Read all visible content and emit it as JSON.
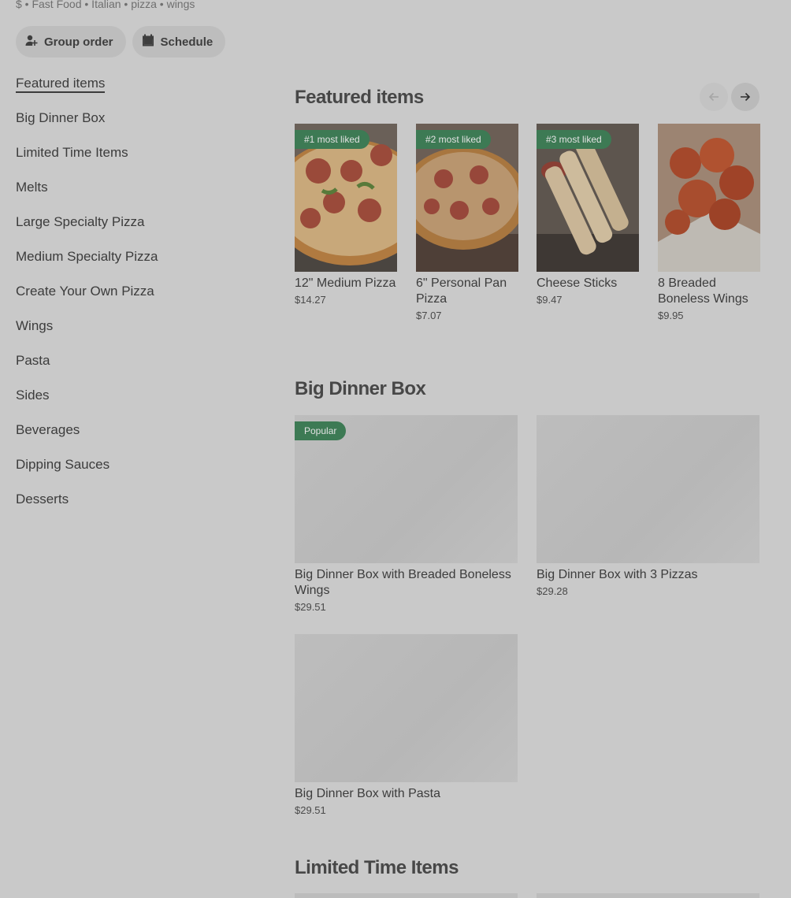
{
  "store": {
    "meta": "$ • Fast Food • Italian • pizza • wings"
  },
  "actions": {
    "group_order": "Group order",
    "schedule": "Schedule"
  },
  "sidebar": {
    "items": [
      {
        "label": "Featured items",
        "active": true
      },
      {
        "label": "Big Dinner Box"
      },
      {
        "label": "Limited Time Items"
      },
      {
        "label": "Melts"
      },
      {
        "label": "Large Specialty Pizza"
      },
      {
        "label": "Medium Specialty Pizza"
      },
      {
        "label": "Create Your Own Pizza"
      },
      {
        "label": "Wings"
      },
      {
        "label": "Pasta"
      },
      {
        "label": "Sides"
      },
      {
        "label": "Beverages"
      },
      {
        "label": "Dipping Sauces"
      },
      {
        "label": "Desserts"
      }
    ]
  },
  "featured": {
    "title": "Featured items",
    "items": [
      {
        "badge": "#1 most liked",
        "name": "12\" Medium Pizza",
        "price": "$14.27"
      },
      {
        "badge": "#2 most liked",
        "name": "6\" Personal Pan Pizza",
        "price": "$7.07"
      },
      {
        "badge": "#3 most liked",
        "name": "Cheese Sticks",
        "price": "$9.47"
      },
      {
        "badge": "",
        "name": "8 Breaded Boneless Wings",
        "price": "$9.95"
      }
    ]
  },
  "big_dinner_box": {
    "title": "Big Dinner Box",
    "items": [
      {
        "badge": "Popular",
        "name": "Big Dinner Box with Breaded Boneless Wings",
        "price": "$29.51"
      },
      {
        "badge": "",
        "name": "Big Dinner Box with 3 Pizzas",
        "price": "$29.28"
      },
      {
        "badge": "",
        "name": "Big Dinner Box with Pasta",
        "price": "$29.51"
      }
    ]
  },
  "limited_time": {
    "title": "Limited Time Items"
  },
  "colors": {
    "overlay_bg": "#c9c9c9",
    "badge_green": "#3d7a54"
  },
  "icons": {
    "group_order": "person-add-icon",
    "schedule": "calendar-icon",
    "prev": "arrow-left-icon",
    "next": "arrow-right-icon"
  }
}
